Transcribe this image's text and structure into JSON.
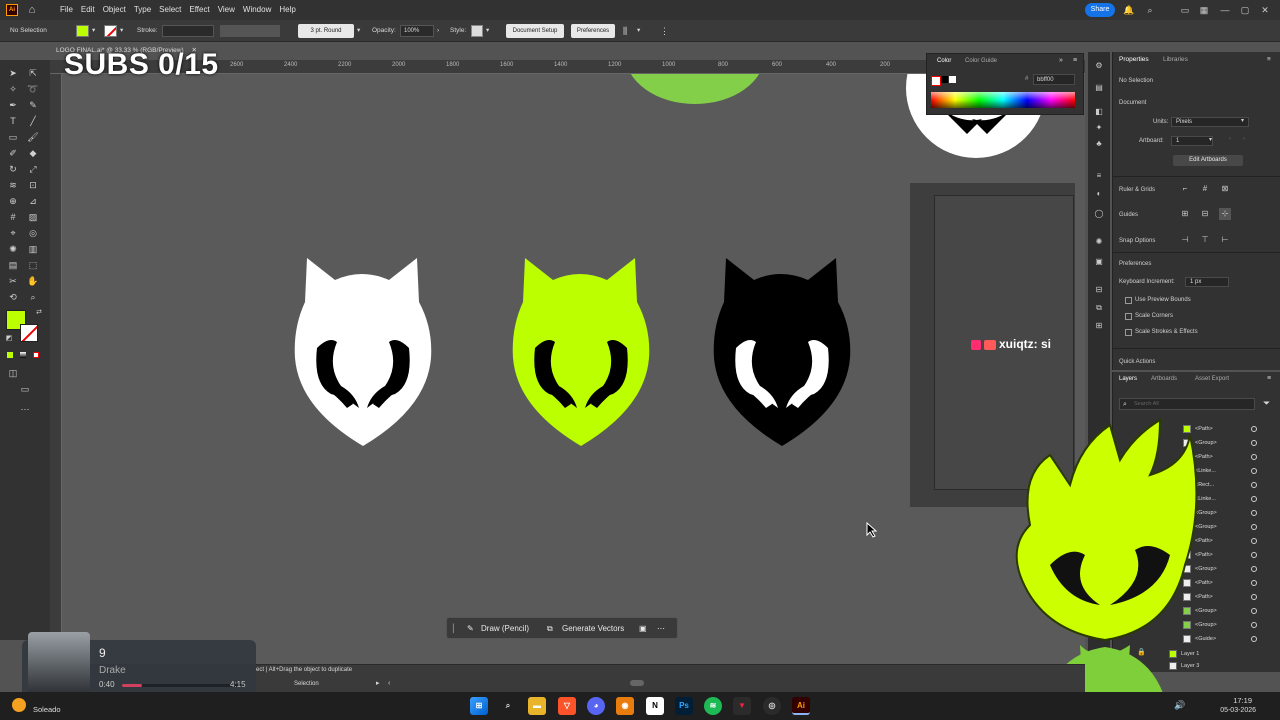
{
  "menubar": {
    "app_logo": "Ai",
    "menus": [
      "File",
      "Edit",
      "Object",
      "Type",
      "Select",
      "Effect",
      "View",
      "Window",
      "Help"
    ],
    "share_label": "Share"
  },
  "control_bar": {
    "selection_status": "No Selection",
    "stroke_label": "Stroke:",
    "brush_label": "3 pt. Round",
    "opacity_label": "Opacity:",
    "opacity_value": "100%",
    "style_label": "Style:",
    "document_setup_label": "Document Setup",
    "preferences_label": "Preferences"
  },
  "document_tab": {
    "title": "LOGO FINAL.ai* @ 33.33 % (RGB/Preview)"
  },
  "overlay": {
    "subs_text": "SUBS 0/15",
    "chat_text": "xuiqtz:  si"
  },
  "ruler": {
    "ticks": [
      "2600",
      "2400",
      "2200",
      "2000",
      "1800",
      "1600",
      "1400",
      "1200",
      "1000",
      "800",
      "600",
      "400",
      "200"
    ]
  },
  "color_panel": {
    "tabs": [
      "Color",
      "Color Guide"
    ],
    "hex_value": "bbff00",
    "accent": "#bbff00"
  },
  "properties_panel": {
    "tabs": [
      "Properties",
      "Libraries"
    ],
    "selection": "No Selection",
    "document_heading": "Document",
    "units_label": "Units:",
    "units_value": "Pixels",
    "artboard_label": "Artboard:",
    "artboard_value": "1",
    "edit_artboards_label": "Edit Artboards",
    "ruler_grids_label": "Ruler & Grids",
    "guides_label": "Guides",
    "snap_options_label": "Snap Options",
    "preferences_heading": "Preferences",
    "keyboard_increment_label": "Keyboard Increment:",
    "keyboard_increment_value": "1 px",
    "use_preview_bounds_label": "Use Preview Bounds",
    "scale_corners_label": "Scale Corners",
    "scale_strokes_label": "Scale Strokes & Effects",
    "quick_actions_label": "Quick Actions"
  },
  "layers_panel": {
    "tabs": [
      "Layers",
      "Artboards",
      "Asset Export"
    ],
    "search_placeholder": "Search All",
    "rows": [
      "<Group>",
      "<Path>",
      "<Group>",
      "<Path>",
      "<Linke...",
      "<Rect...",
      "<Linke...",
      "<Group>",
      "<Group>",
      "<Path>",
      "<Path>",
      "<Group>",
      "<Path>",
      "<Path>",
      "<Group>",
      "<Group>",
      "<Guide>"
    ],
    "layer1": "Layer 1",
    "layer3": "Layer 3"
  },
  "context_bar": {
    "draw_label": "Draw (Pencil)",
    "generate_label": "Generate Vectors"
  },
  "status_bar": {
    "hint": "ect  |  Alt+Drag the object to duplicate",
    "tool": "Selection"
  },
  "music": {
    "track": "9",
    "artist": "Drake",
    "elapsed": "0:40",
    "duration": "4:15",
    "progress": 0.16
  },
  "taskbar": {
    "weather": "Soleado",
    "time": "17:19",
    "date": "05-03-2026"
  },
  "logos": {
    "colors": [
      "#ffffff",
      "#bbff00",
      "#000000"
    ]
  }
}
